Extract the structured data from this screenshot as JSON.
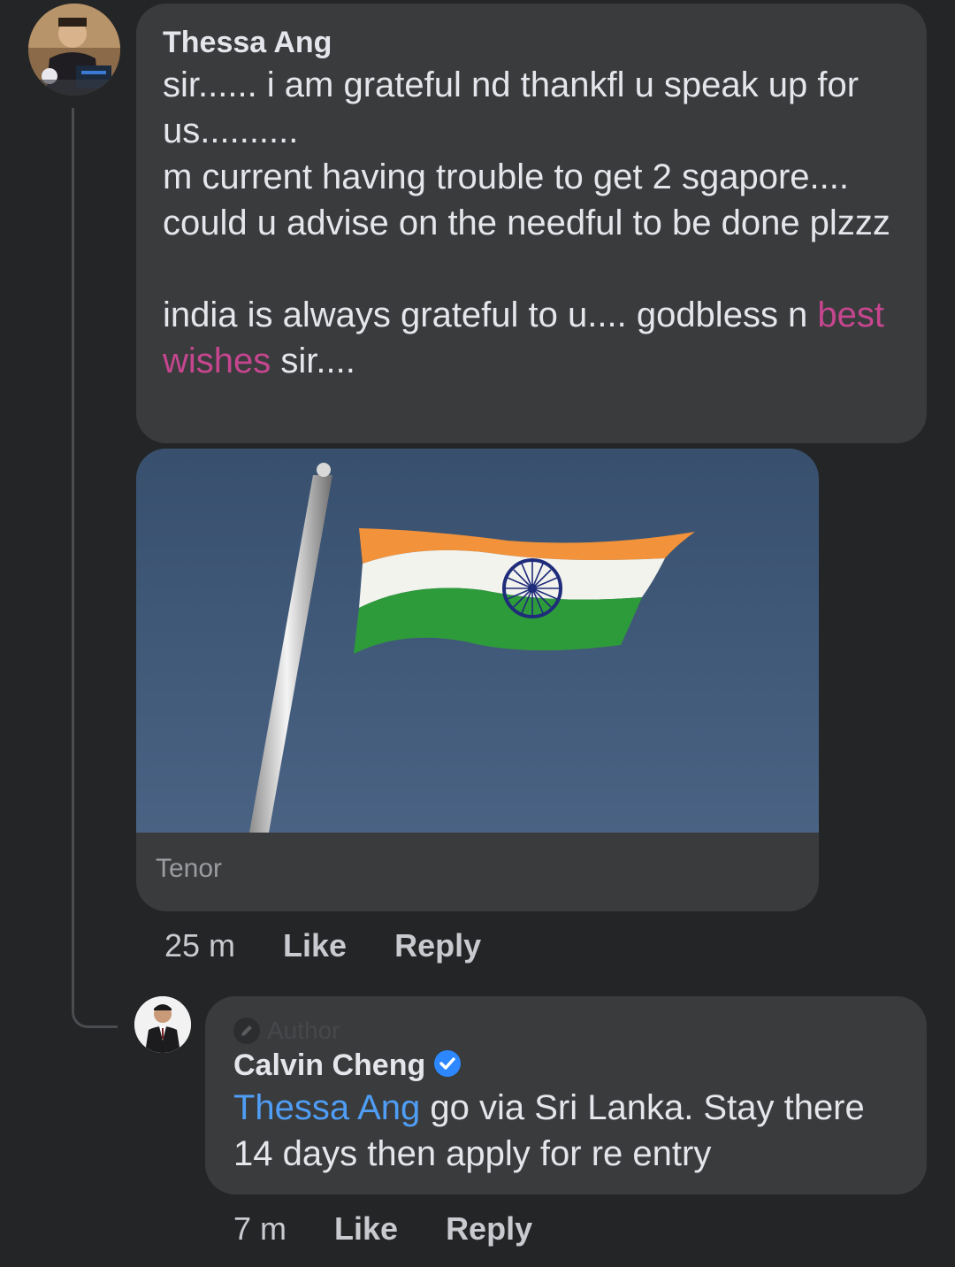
{
  "comment": {
    "author": "Thessa Ang",
    "text_main": "sir...... i am grateful nd thankfl u speak up for us..........\nm current having trouble to get 2 sgapore.... could u advise on the needful to be done plzzz\n\nindia is always grateful to u.... godbless n ",
    "highlighted": "best wishes",
    "text_end": " sir....",
    "gif_source": "Tenor",
    "time": "25 m",
    "like_label": "Like",
    "reply_label": "Reply"
  },
  "reply": {
    "badge": "Author",
    "author": "Calvin Cheng",
    "mention": "Thessa Ang",
    "text": " go via Sri Lanka. Stay there 14 days then apply for re entry",
    "time": "7 m",
    "like_label": "Like",
    "reply_label": "Reply"
  },
  "colors": {
    "background": "#242526",
    "bubble": "#3a3b3c",
    "mention": "#4f9df5",
    "highlight": "#c5468f",
    "verified": "#2d88ff"
  },
  "icons": {
    "pencil": "pencil-icon",
    "verified": "verified-check-icon"
  }
}
